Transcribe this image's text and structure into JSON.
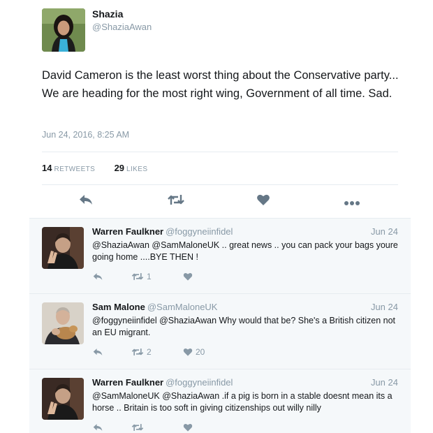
{
  "tweet": {
    "name": "Shazia",
    "handle": "@ShaziaAwan",
    "text": "David Cameron is the least worst thing about the Conservative party... We are heading for the most right wing, Government of all time. Sad.",
    "date": "Jun 24, 2016, 8:25 AM",
    "retweets_count": "14",
    "retweets_label": "RETWEETS",
    "likes_count": "29",
    "likes_label": "LIKES",
    "action_icons": [
      "reply-icon",
      "retweet-icon",
      "like-icon",
      "more-icon"
    ]
  },
  "replies": [
    {
      "name": "Warren Faulkner",
      "handle": "@foggyneiinfidel",
      "date": "Jun 24",
      "text": "@ShaziaAwan @SamMaloneUK .. great news .. you can pack your bags youre going home ....BYE THEN !",
      "retweets": "1",
      "likes": ""
    },
    {
      "name": "Sam Malone",
      "handle": "@SamMaloneUK",
      "date": "Jun 24",
      "text": "@foggyneiinfidel @ShaziaAwan Why would that be? She's a British citizen not an EU migrant.",
      "retweets": "2",
      "likes": "20"
    },
    {
      "name": "Warren Faulkner",
      "handle": "@foggyneiinfidel",
      "date": "Jun 24",
      "text": "@SamMaloneUK @ShaziaAwan .if a pig is born in a stable doesnt mean its a horse .. Britain is too soft in giving citizenships out willy nilly",
      "retweets": "",
      "likes": ""
    }
  ],
  "colors": {
    "text": "#14171a",
    "muted": "#8899a6",
    "icon": "#657786",
    "divider": "#e6ecf0",
    "reply_bg": "#f5f8fa"
  }
}
